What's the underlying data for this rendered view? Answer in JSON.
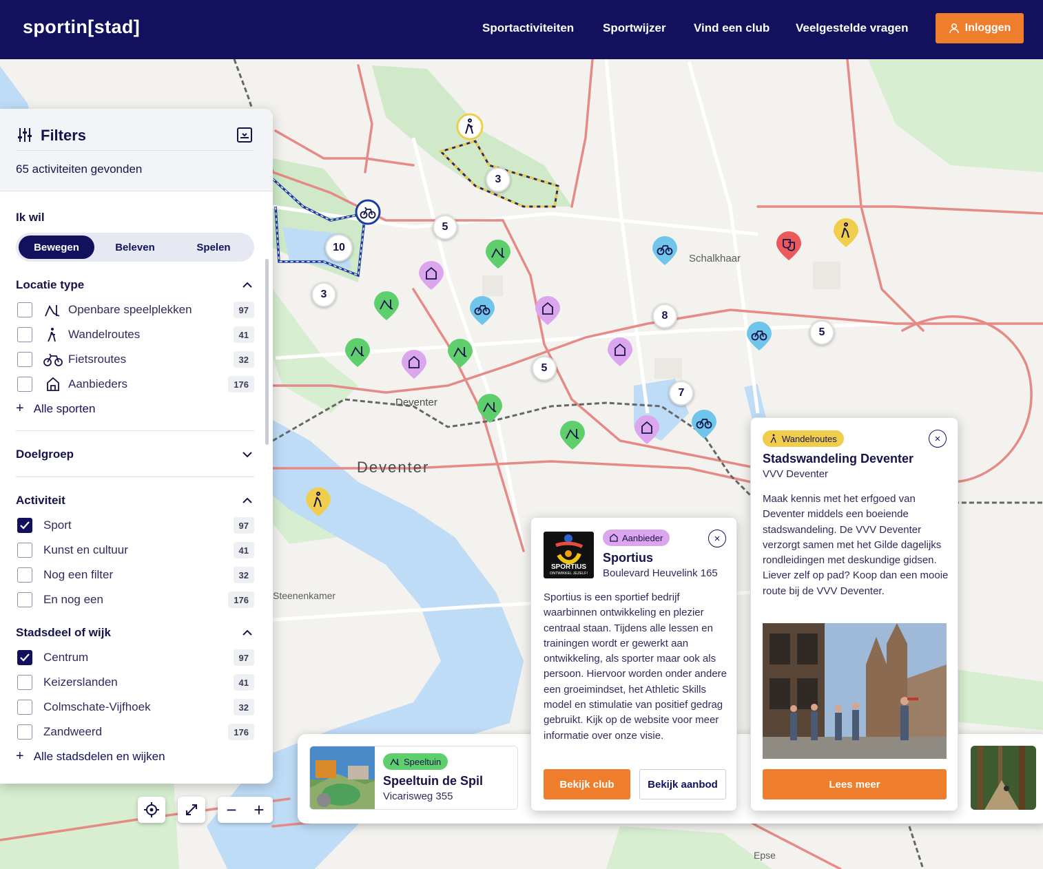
{
  "header": {
    "logo": "sportin[stad]",
    "nav": [
      "Sportactiviteiten",
      "Sportwijzer",
      "Vind een club",
      "Veelgestelde vragen"
    ],
    "login": "Inloggen"
  },
  "filters": {
    "title": "Filters",
    "count": "65 activiteiten gevonden",
    "ik_wil": "Ik wil",
    "tabs": [
      "Bewegen",
      "Beleven",
      "Spelen"
    ],
    "locatie_type": {
      "title": "Locatie type",
      "items": [
        {
          "label": "Openbare speelplekken",
          "count": "97"
        },
        {
          "label": "Wandelroutes",
          "count": "41"
        },
        {
          "label": "Fietsroutes",
          "count": "32"
        },
        {
          "label": "Aanbieders",
          "count": "176"
        }
      ],
      "more": "Alle sporten"
    },
    "doelgroep": "Doelgroep",
    "activiteit": {
      "title": "Activiteit",
      "items": [
        {
          "label": "Sport",
          "count": "97",
          "checked": true
        },
        {
          "label": "Kunst en cultuur",
          "count": "41",
          "checked": false
        },
        {
          "label": "Nog een filter",
          "count": "32",
          "checked": false
        },
        {
          "label": "En nog een",
          "count": "176",
          "checked": false
        }
      ]
    },
    "stadsdeel": {
      "title": "Stadsdeel of wijk",
      "items": [
        {
          "label": "Centrum",
          "count": "97",
          "checked": true
        },
        {
          "label": "Keizerslanden",
          "count": "41",
          "checked": false
        },
        {
          "label": "Colmschate-Vijfhoek",
          "count": "32",
          "checked": false
        },
        {
          "label": "Zandweerd",
          "count": "176",
          "checked": false
        }
      ],
      "more": "Alle stadsdelen en wijken"
    }
  },
  "map": {
    "labels": [
      "Schalkhaar",
      "Deventer",
      "Deventer",
      "Steenenkamer",
      "Epse"
    ],
    "clusters": [
      "3",
      "5",
      "10",
      "3",
      "8",
      "5",
      "5",
      "7"
    ]
  },
  "cards": {
    "speeltuin": {
      "tag": "Speeltuin",
      "title": "Speeltuin de Spil",
      "address": "Vicarisweg 355"
    },
    "sportius": {
      "tag": "Aanbieder",
      "title": "Sportius",
      "address": "Boulevard Heuvelink 165",
      "logo_text": "SPORTIUS",
      "logo_sub": "ONTWIKKEL JEZELF!",
      "body": "Sportius is een sportief bedrijf waarbinnen ontwikkeling en plezier centraal staan. Tijdens alle lessen en trainingen wordt er gewerkt aan ontwikkeling, als sporter maar ook als persoon. Hiervoor worden onder andere een groeimindset, het Athletic Skills model en stimulatie van positief gedrag gebruikt. Kijk op de website voor meer informatie over onze visie.",
      "btn1": "Bekijk club",
      "btn2": "Bekijk aanbod"
    },
    "stadswandeling": {
      "tag": "Wandelroutes",
      "title": "Stadswandeling Deventer",
      "org": "VVV Deventer",
      "body": "Maak kennis met het erfgoed van Deventer middels een boeiende stadswandeling. De VVV Deventer verzorgt samen met het Gilde dagelijks rondleidingen met deskundige gidsen. Liever zelf op pad? Koop dan een mooie route bij de VVV Deventer.",
      "btn": "Lees meer"
    }
  },
  "colors": {
    "navy": "#13115e",
    "orange": "#ee7d2c",
    "green": "#5fcf6e",
    "purple": "#dba6ee",
    "blue": "#6fc6ea",
    "yellow": "#f1cd4e",
    "red": "#ea5a5a"
  }
}
